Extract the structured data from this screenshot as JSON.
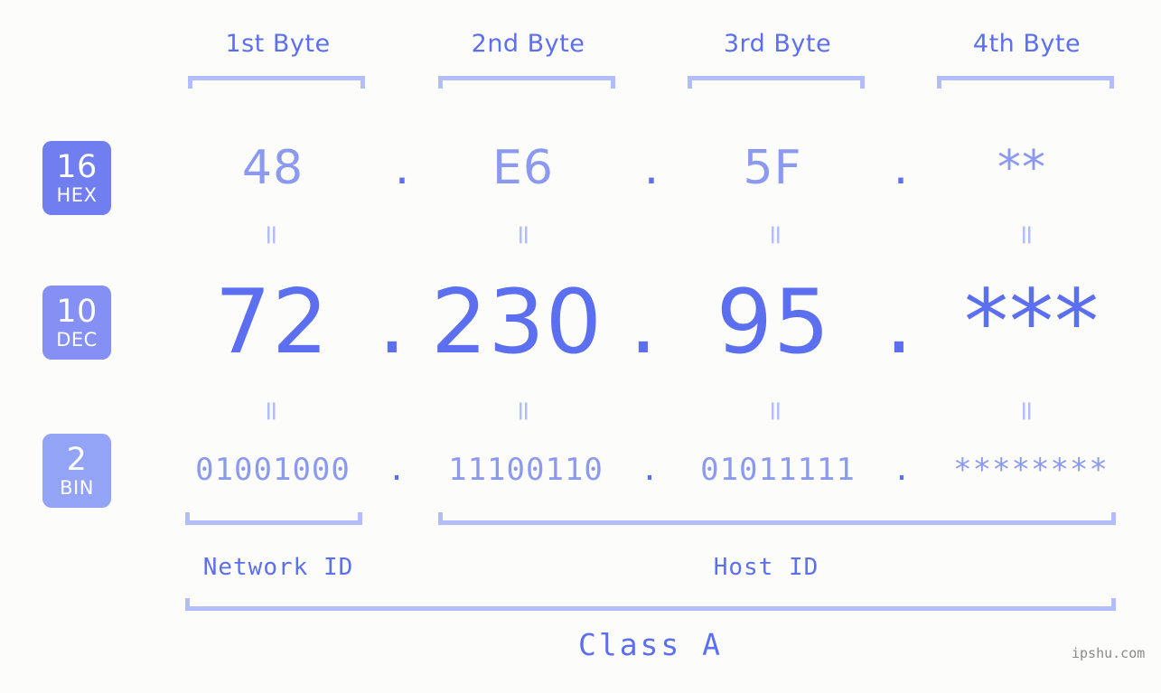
{
  "theme": {
    "background": "#fcfdfa",
    "accent_strong": "#5c6ff0",
    "accent_light": "#8b9af0",
    "bracket": "#b3bdfb",
    "badge_hex": "#707ef0",
    "badge_dec": "#8490f3",
    "badge_bin": "#93a4f7",
    "watermark": "#8a8a8a"
  },
  "byte_headers": [
    {
      "label": "1st Byte"
    },
    {
      "label": "2nd Byte"
    },
    {
      "label": "3rd Byte"
    },
    {
      "label": "4th Byte"
    }
  ],
  "bases": [
    {
      "number": "16",
      "name": "HEX"
    },
    {
      "number": "10",
      "name": "DEC"
    },
    {
      "number": "2",
      "name": "BIN"
    }
  ],
  "separator": ".",
  "equals_glyph": "=",
  "rows": {
    "hex": {
      "base_number": "16",
      "base_name": "HEX",
      "values": [
        "48",
        "E6",
        "5F",
        "**"
      ]
    },
    "dec": {
      "base_number": "10",
      "base_name": "DEC",
      "values": [
        "72",
        "230",
        "95",
        "***"
      ]
    },
    "bin": {
      "base_number": "2",
      "base_name": "BIN",
      "values": [
        "01001000",
        "11100110",
        "01011111",
        "********"
      ]
    }
  },
  "footer": {
    "network_id_label": "Network ID",
    "host_id_label": "Host ID",
    "class_label": "Class A",
    "watermark": "ipshu.com"
  }
}
